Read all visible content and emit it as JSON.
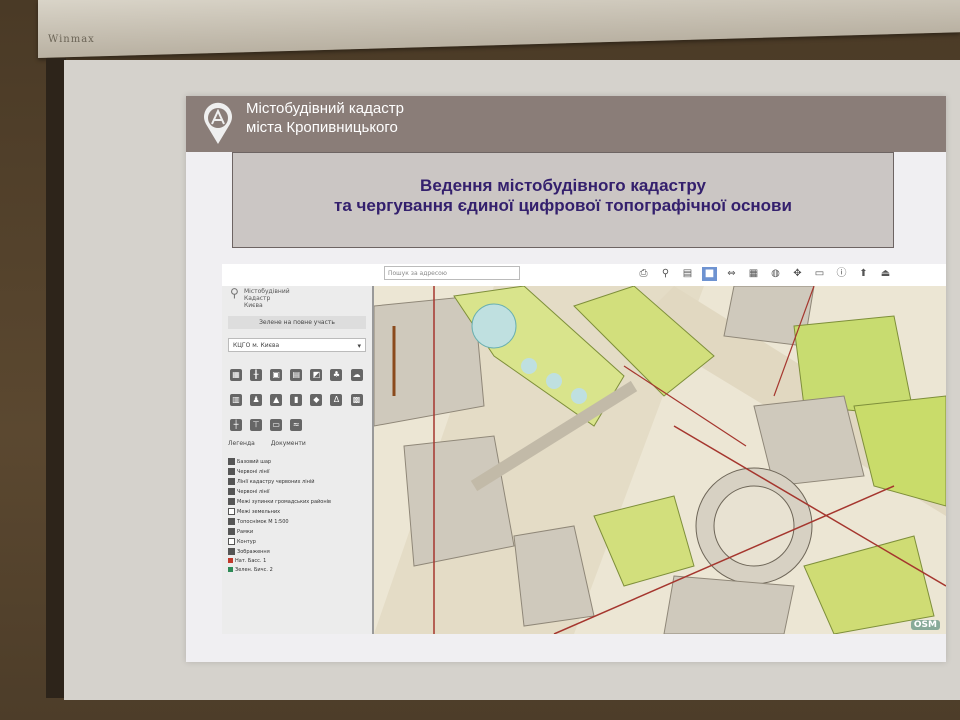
{
  "projector": {
    "brand": "Winmax"
  },
  "slide": {
    "header": {
      "line1": "Містобудівний кадастр",
      "line2": "міста Кропивницького"
    },
    "title": {
      "line1": "Ведення містобудівного кадастру",
      "line2": "та чергування єдиної цифрової топографічної основи"
    }
  },
  "app": {
    "brand": {
      "line1": "Містобудівний",
      "line2": "Кадастр Києва"
    },
    "join_button": "Зелене на повне участь",
    "region_select": "КЦГО м. Києва",
    "map_search_placeholder": "Пошук за адресою",
    "tabs": [
      "Легенда",
      "Документи"
    ],
    "layers": [
      {
        "label": "Базовий шар",
        "checked": true
      },
      {
        "label": "Червоні лінії",
        "checked": true
      },
      {
        "label": "Лінії кадастру червоних ліній",
        "checked": true
      },
      {
        "label": "Червоні лінії",
        "checked": true
      },
      {
        "label": "Межі зупинки громадських районів",
        "checked": true
      },
      {
        "label": "Межі земельних",
        "checked": false
      },
      {
        "label": "Топоснімок М 1:500",
        "checked": true
      },
      {
        "label": "Рамки",
        "checked": true
      },
      {
        "label": "Контур",
        "checked": false
      },
      {
        "label": "Зображення",
        "checked": true
      },
      {
        "label": "Нат. Басс. 1",
        "checked": false,
        "swatch": "#c0392b"
      },
      {
        "label": "Зелен. Бичс. 2",
        "checked": false,
        "swatch": "#2e8b57"
      }
    ],
    "toolbar_icons": [
      "print-icon",
      "pin-icon",
      "layers-icon",
      "select-icon",
      "measure-icon",
      "table-icon",
      "globe-icon",
      "move-icon",
      "ruler-icon",
      "info-icon",
      "upload-icon",
      "exit-icon"
    ],
    "osm_mark": "OSM"
  },
  "colors": {
    "header_bg": "#8a7d78",
    "title_text": "#34206d",
    "map_green": "#c9dc6a",
    "map_building": "#c7c2b6",
    "map_red_line": "#a5362e"
  }
}
